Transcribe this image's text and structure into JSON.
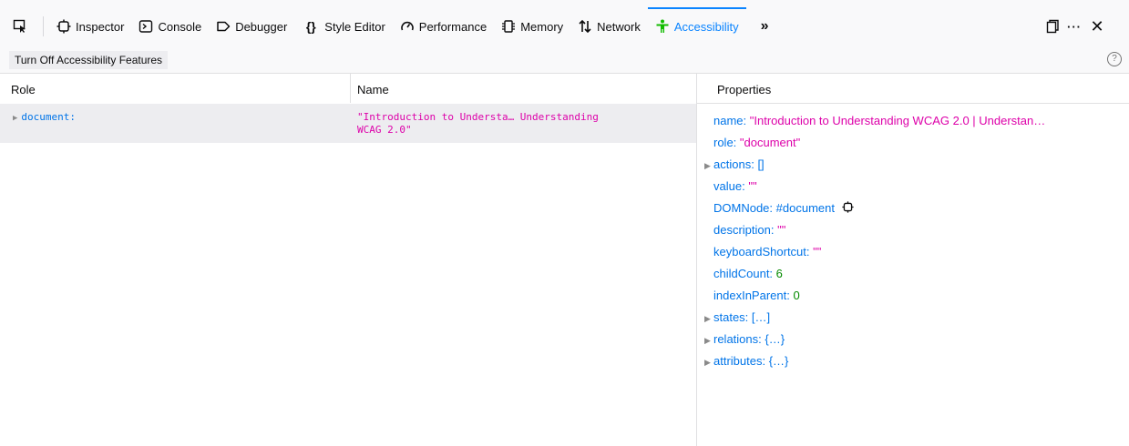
{
  "toolbar": {
    "tabs": [
      {
        "label": "Inspector",
        "icon": "inspector-icon"
      },
      {
        "label": "Console",
        "icon": "console-icon"
      },
      {
        "label": "Debugger",
        "icon": "debugger-icon"
      },
      {
        "label": "Style Editor",
        "icon": "style-editor-icon"
      },
      {
        "label": "Performance",
        "icon": "performance-icon"
      },
      {
        "label": "Memory",
        "icon": "memory-icon"
      },
      {
        "label": "Network",
        "icon": "network-icon"
      },
      {
        "label": "Accessibility",
        "icon": "accessibility-icon",
        "active": true
      }
    ],
    "accent_color": "#0a84ff"
  },
  "subbar": {
    "turn_off_label": "Turn Off Accessibility Features"
  },
  "tree": {
    "columns": {
      "role": "Role",
      "name": "Name"
    },
    "rows": [
      {
        "role": "document:",
        "name_line1": "\"Introduction to Understa… Understanding",
        "name_line2": "WCAG 2.0\""
      }
    ]
  },
  "properties": {
    "header": "Properties",
    "items": [
      {
        "key": "name:",
        "value": "\"Introduction to Understanding WCAG 2.0 | Understan…",
        "kind": "string"
      },
      {
        "key": "role:",
        "value": "\"document\"",
        "kind": "string"
      },
      {
        "key": "actions:",
        "value": "[]",
        "kind": "group",
        "expandable": true
      },
      {
        "key": "value:",
        "value": "\"\"",
        "kind": "string"
      },
      {
        "key": "DOMNode:",
        "value": "#document",
        "kind": "node"
      },
      {
        "key": "description:",
        "value": "\"\"",
        "kind": "string"
      },
      {
        "key": "keyboardShortcut:",
        "value": "\"\"",
        "kind": "string"
      },
      {
        "key": "childCount:",
        "value": "6",
        "kind": "number"
      },
      {
        "key": "indexInParent:",
        "value": "0",
        "kind": "number"
      },
      {
        "key": "states:",
        "value": "[…]",
        "kind": "group",
        "expandable": true
      },
      {
        "key": "relations:",
        "value": "{…}",
        "kind": "group",
        "expandable": true
      },
      {
        "key": "attributes:",
        "value": "{…}",
        "kind": "group",
        "expandable": true
      }
    ]
  }
}
